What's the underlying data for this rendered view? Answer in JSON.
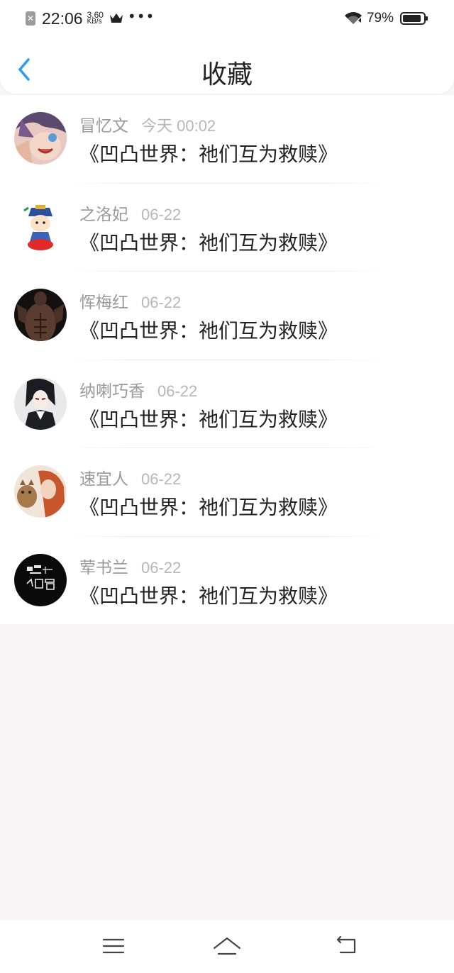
{
  "status_bar": {
    "time": "22:06",
    "speed_value": "3.60",
    "speed_unit": "KB/s",
    "battery": "79%",
    "icons": [
      "notification-blocked-icon",
      "crown-icon",
      "more-dots-icon",
      "wifi-icon",
      "battery-icon"
    ]
  },
  "header": {
    "title": "收藏",
    "back_icon": "chevron-left-icon",
    "accent_color": "#2e9bf0"
  },
  "favorites": [
    {
      "name": "冒忆文",
      "time": "今天 00:02",
      "title": "《凹凸世界：祂们互为救赎》",
      "avatar": "anime-character-avatar"
    },
    {
      "name": "之洛妃",
      "time": "06-22",
      "title": "《凹凸世界：祂们互为救赎》",
      "avatar": "cartoon-emperor-avatar"
    },
    {
      "name": "恽梅红",
      "time": "06-22",
      "title": "《凹凸世界：祂们互为救赎》",
      "avatar": "muscular-figure-avatar"
    },
    {
      "name": "纳喇巧香",
      "time": "06-22",
      "title": "《凹凸世界：祂们互为救赎》",
      "avatar": "butler-character-avatar"
    },
    {
      "name": "速宜人",
      "time": "06-22",
      "title": "《凹凸世界：祂们互为救赎》",
      "avatar": "girl-with-cat-avatar"
    },
    {
      "name": "荤书兰",
      "time": "06-22",
      "title": "《凹凸世界：祂们互为救赎》",
      "avatar": "black-calligraphy-avatar"
    }
  ],
  "bottom_nav": {
    "icons": [
      "menu-icon",
      "home-icon",
      "back-icon"
    ]
  }
}
